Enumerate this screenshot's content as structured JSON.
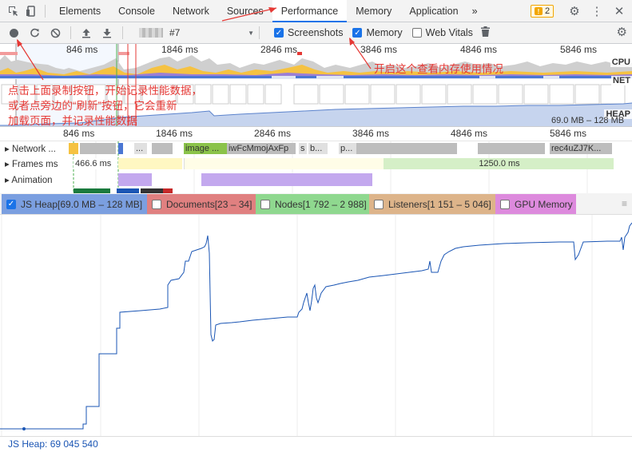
{
  "tabs": {
    "items": [
      "Elements",
      "Console",
      "Network",
      "Sources",
      "Performance",
      "Memory",
      "Application"
    ],
    "active": "Performance",
    "more": "»",
    "issues_count": "2"
  },
  "toolbar": {
    "profile_label": "#7",
    "checkboxes": [
      {
        "label": "Screenshots",
        "checked": true
      },
      {
        "label": "Memory",
        "checked": true
      },
      {
        "label": "Web Vitals",
        "checked": false
      }
    ]
  },
  "overview": {
    "ruler": [
      "846 ms",
      "1846 ms",
      "2846 ms",
      "3846 ms",
      "4846 ms",
      "5846 ms"
    ],
    "lanes": [
      "CPU",
      "NET",
      "HEAP"
    ],
    "heap_range": "69.0 MB – 128 MB"
  },
  "flame": {
    "ruler": [
      "846 ms",
      "1846 ms",
      "2846 ms",
      "3846 ms",
      "4846 ms",
      "5846 ms"
    ],
    "tracks": {
      "network": {
        "name": "Network",
        "short": "...",
        "segments": [
          "...",
          "image ...",
          "iwFcMmojAxFp",
          "s",
          "b...",
          "p...",
          "rec4uZJ7K..."
        ]
      },
      "frames": {
        "name": "Frames",
        "prefix": "ms",
        "value1": "466.6 ms",
        "value2": "1250.0 ms"
      },
      "animation": {
        "name": "Animation"
      }
    }
  },
  "counters": [
    {
      "label": "JS Heap[69.0 MB – 128 MB]",
      "checked": true,
      "color": "#7b9fe0"
    },
    {
      "label": "Documents[23 – 34]",
      "checked": false,
      "color": "#e08080"
    },
    {
      "label": "Nodes[1 792 – 2 988]",
      "checked": false,
      "color": "#8fd88f"
    },
    {
      "label": "Listeners[1 151 – 5 046]",
      "checked": false,
      "color": "#ddb48a"
    },
    {
      "label": "GPU Memory",
      "checked": false,
      "color": "#dd8add"
    }
  ],
  "status": "JS Heap: 69 045 540",
  "annotations": {
    "memory_tip": "开启这个查看内存使用情况",
    "record_tip": [
      "点击上面录制按钮，开始记录性能数据，",
      "或者点旁边的“刷新”按钮，它会重新",
      "加载页面，并记录性能数据"
    ]
  },
  "colors": {
    "accent": "#1a73e8",
    "annotation": "#e53935",
    "heap_line": "#1a55b4"
  }
}
